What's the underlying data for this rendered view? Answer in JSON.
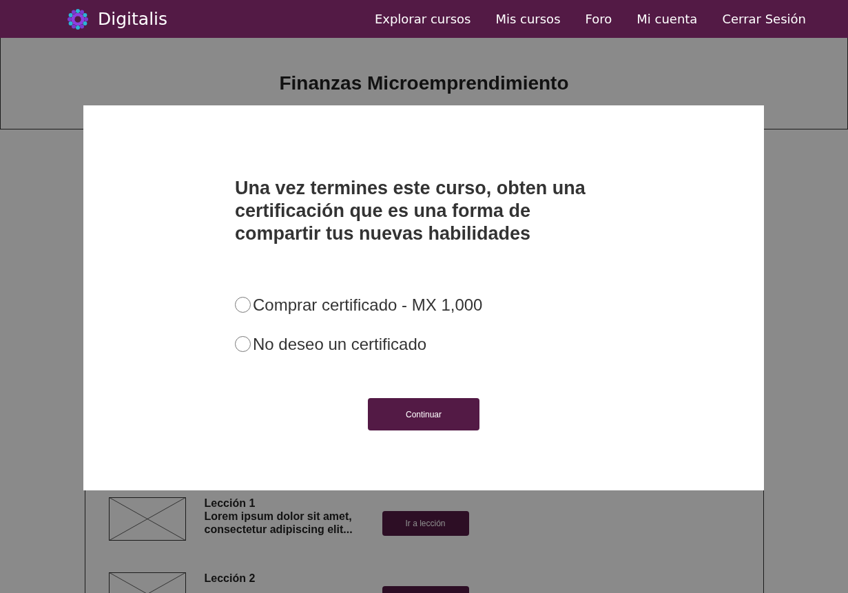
{
  "navbar": {
    "brand": "Digitalis",
    "links": [
      "Explorar cursos",
      "Mis cursos",
      "Foro",
      "Mi cuenta",
      "Cerrar Sesión"
    ]
  },
  "course": {
    "title": "Finanzas Microemprendimiento"
  },
  "lessons": [
    {
      "title": "Lección 1",
      "description": "Lorem ipsum dolor sit amet, consectetur adipiscing elit...",
      "button": "Ir a lección"
    },
    {
      "title": "Lección 2"
    }
  ],
  "modal": {
    "question": "Una vez termines este curso, obten una certificación que es una forma de compartir tus nuevas habilidades",
    "options": [
      {
        "label": "Comprar certificado - MX 1,000",
        "selected": false
      },
      {
        "label": "No deseo un certificado",
        "selected": false
      }
    ],
    "button": "Continuar"
  }
}
